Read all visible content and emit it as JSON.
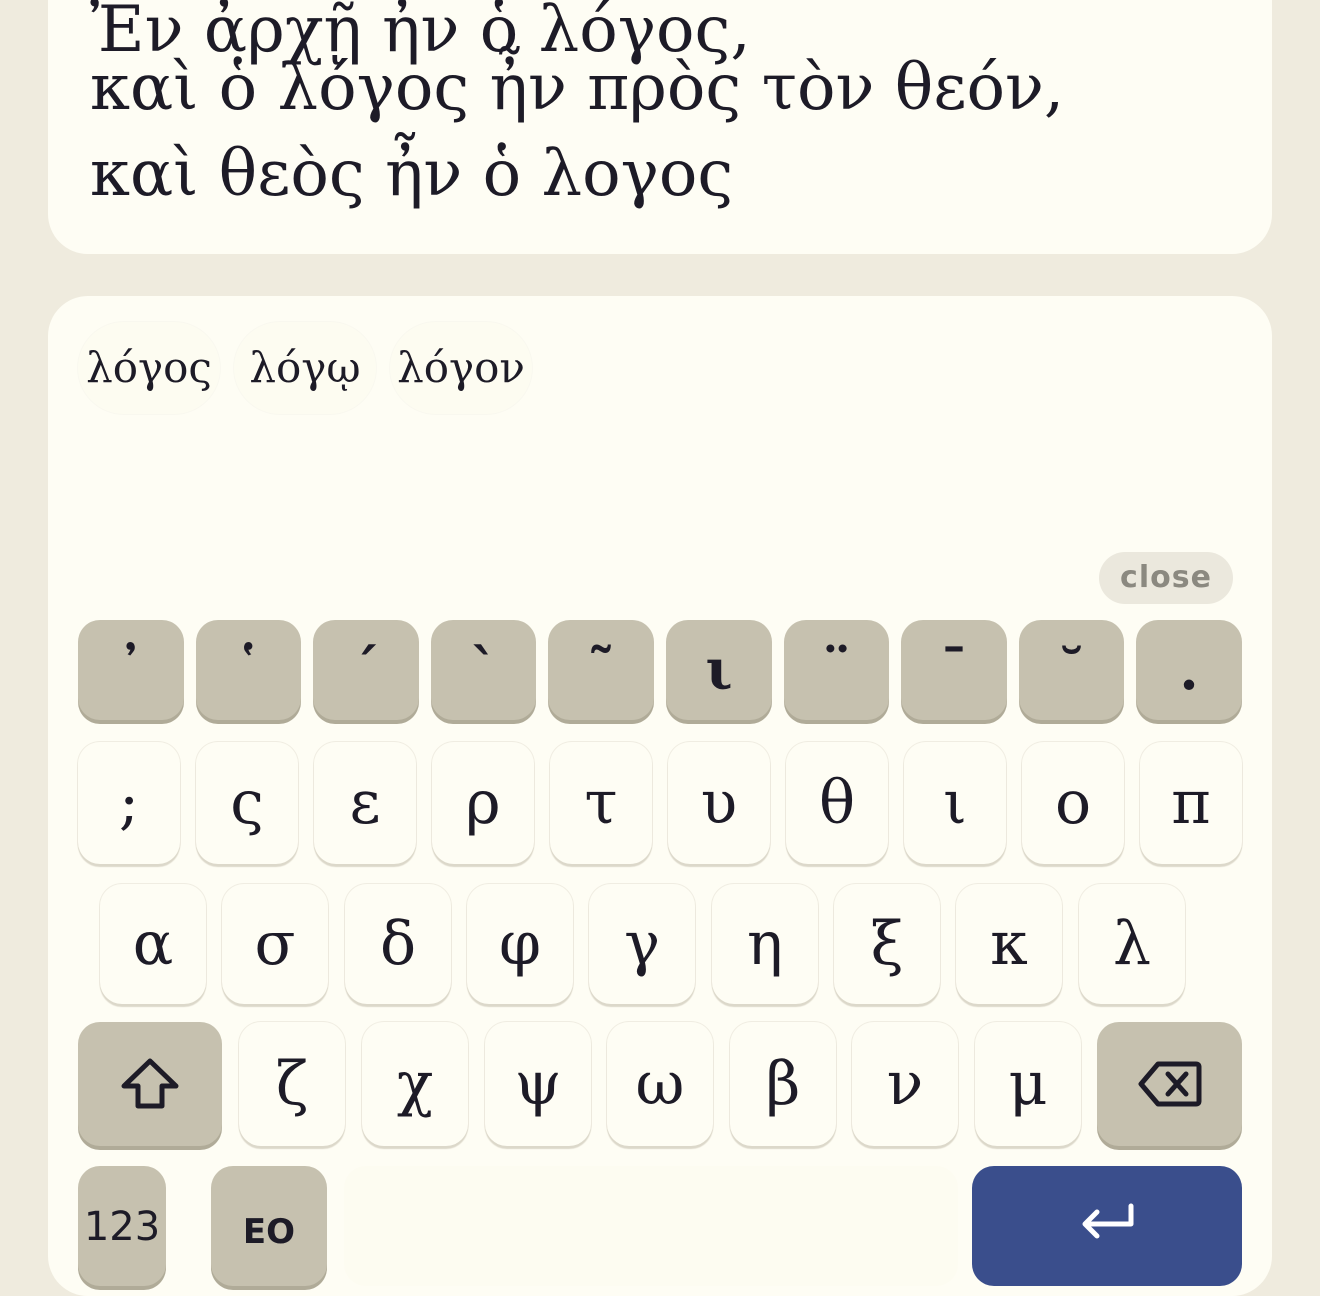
{
  "text_lines": [
    "Ἐν ἀρχῇ ἦν ὁ λόγος,",
    "καὶ ὁ λόγος ἦν πρὸς τὸν θεόν,",
    "καὶ θεὸς ἦν ὁ λογος"
  ],
  "suggestions": [
    "λόγος",
    "λόγῳ",
    "λόγον"
  ],
  "close_label": "close",
  "diacritics_row": [
    "᾿",
    "῾",
    "΄",
    "`",
    "῀",
    "ι",
    "¨",
    "¯",
    "˘",
    "."
  ],
  "row1": [
    ";",
    "ς",
    "ε",
    "ρ",
    "τ",
    "υ",
    "θ",
    "ι",
    "ο",
    "π"
  ],
  "row2": [
    "α",
    "σ",
    "δ",
    "φ",
    "γ",
    "η",
    "ξ",
    "κ",
    "λ"
  ],
  "row3": [
    "ζ",
    "χ",
    "ψ",
    "ω",
    "β",
    "ν",
    "μ"
  ],
  "mode_keys": {
    "numbers": "123",
    "emoji": "EO"
  },
  "icons": {
    "shift": "shift-arrow-icon",
    "backspace": "backspace-icon",
    "enter": "return-arrow-icon"
  },
  "colors": {
    "enter_key": "#3a4e8c",
    "modifier_key": "#c6c1af",
    "page_bg": "#efebde",
    "card_bg": "#fefdf4"
  }
}
